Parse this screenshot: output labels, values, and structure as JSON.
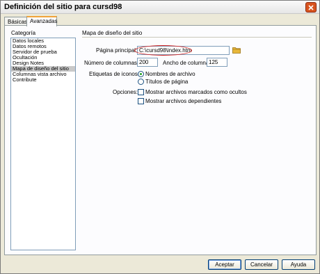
{
  "window": {
    "title": "Definición del sitio para cursd98"
  },
  "tabs": [
    {
      "label": "Básicas"
    },
    {
      "label": "Avanzadas"
    }
  ],
  "sidebar": {
    "heading": "Categoría",
    "items": [
      {
        "label": "Datos locales"
      },
      {
        "label": "Datos remotos"
      },
      {
        "label": "Servidor de prueba"
      },
      {
        "label": "Ocultación"
      },
      {
        "label": "Design Notes"
      },
      {
        "label": "Mapa de diseño del sitio"
      },
      {
        "label": "Columnas vista archivo"
      },
      {
        "label": "Contribute"
      }
    ],
    "selected": "Mapa de diseño del sitio"
  },
  "main": {
    "section_title": "Mapa de diseño del sitio",
    "home_page": {
      "label": "Página principal:",
      "value": "C:\\cursd98\\index.htm"
    },
    "num_columns": {
      "label": "Número de columnas:",
      "value": "200"
    },
    "column_width": {
      "label": "Ancho de columna:",
      "value": "125"
    },
    "icon_labels": {
      "label": "Etiquetas de iconos:",
      "options": [
        {
          "label": "Nombres de archivo",
          "checked": true
        },
        {
          "label": "Títulos de página",
          "checked": false
        }
      ]
    },
    "options": {
      "label": "Opciones:",
      "items": [
        {
          "label": "Mostrar archivos marcados como ocultos",
          "checked": false
        },
        {
          "label": "Mostrar archivos dependientes",
          "checked": false
        }
      ]
    }
  },
  "footer": {
    "ok_label": "Aceptar",
    "cancel_label": "Cancelar",
    "help_label": "Ayuda"
  },
  "colors": {
    "highlight_oval": "#d42020",
    "folder_icon": "#e8b83a",
    "close_button": "#d8541f"
  }
}
